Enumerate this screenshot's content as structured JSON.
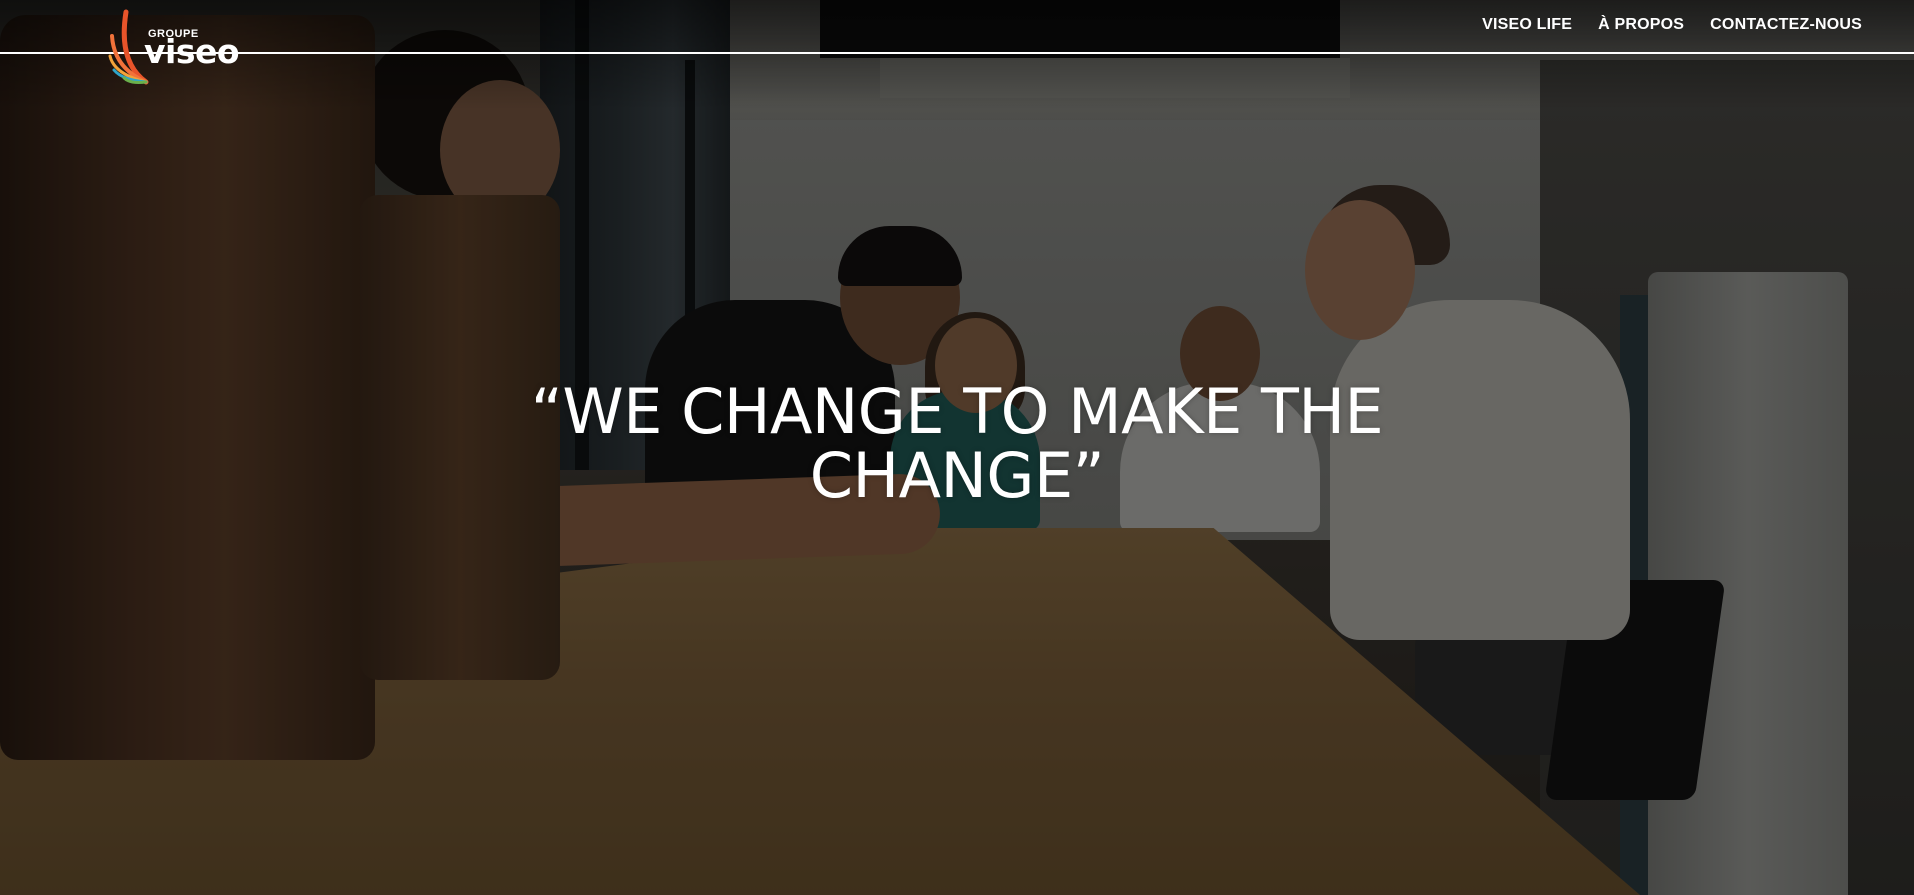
{
  "brand": {
    "logo_top": "GROUPE",
    "logo_main": "viseo",
    "icon": "fan-feather-logo",
    "colors": [
      "#e8542a",
      "#f2a33a",
      "#2fa5c9",
      "#6ab04c"
    ]
  },
  "nav": {
    "items": [
      {
        "label": "VISEO LIFE"
      },
      {
        "label": "À PROPOS"
      },
      {
        "label": "CONTACTEZ-NOUS"
      }
    ]
  },
  "hero": {
    "quote": "“WE CHANGE TO MAKE THE CHANGE”"
  },
  "colors": {
    "text": "#ffffff",
    "header_line": "#ffffff"
  }
}
